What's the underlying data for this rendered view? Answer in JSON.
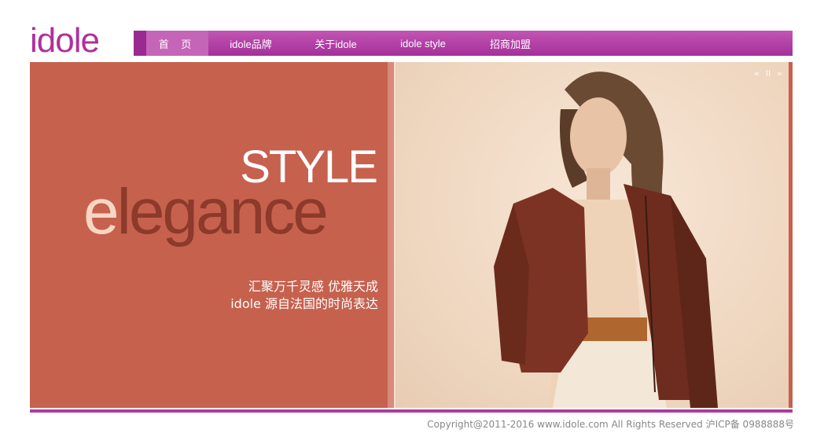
{
  "logo": {
    "text": "idole"
  },
  "nav": {
    "items": [
      {
        "label": "首 页",
        "active": true
      },
      {
        "label": "idole品牌"
      },
      {
        "label": "关于idole"
      },
      {
        "label": "idole style"
      },
      {
        "label": "招商加盟"
      }
    ]
  },
  "hero": {
    "title_top": "STYLE",
    "title_main_first": "e",
    "title_main_rest": "legance",
    "tagline_1": "汇聚万千灵感  优雅天成",
    "tagline_2": "idole 源自法国的时尚表达",
    "controls": {
      "prev": "«",
      "pause": "II",
      "next": "»"
    }
  },
  "footer": {
    "copyright": "Copyright@2011-2016 www.idole.com All Rights Reserved  沪ICP备 0988888号"
  },
  "colors": {
    "brand": "#b0309a",
    "panel": "#c6614e"
  }
}
